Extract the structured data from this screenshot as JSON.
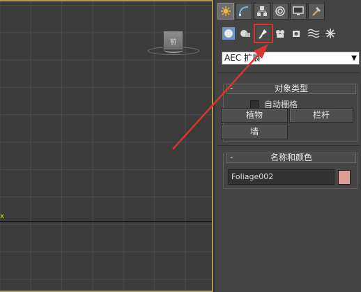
{
  "viewport": {
    "axis_label": "x",
    "gizmo_label": "前"
  },
  "panel": {
    "tabs": [
      {
        "name": "create-tab-icon",
        "glyph": "✸",
        "active": true
      },
      {
        "name": "modify-tab-icon",
        "glyph": "◜"
      },
      {
        "name": "hierarchy-tab-icon",
        "glyph": "⚑"
      },
      {
        "name": "motion-tab-icon",
        "glyph": "◎"
      },
      {
        "name": "display-tab-icon",
        "glyph": "▭"
      },
      {
        "name": "utilities-tab-icon",
        "glyph": "⚒"
      }
    ],
    "subcategory_icons": [
      {
        "name": "geometry-icon",
        "glyph": "●"
      },
      {
        "name": "shapes-icon",
        "glyph": "◐"
      },
      {
        "name": "lights-icon",
        "glyph": "✎",
        "selected": true
      },
      {
        "name": "cameras-icon",
        "glyph": "⊙"
      },
      {
        "name": "helpers-icon",
        "glyph": "◨"
      },
      {
        "name": "space-warps-icon",
        "glyph": "≋"
      },
      {
        "name": "systems-icon",
        "glyph": "✱"
      }
    ],
    "dropdown": {
      "selected": "AEC 扩展"
    },
    "object_type": {
      "title": "对象类型",
      "toggle": "-",
      "autogrid_label": "自动栅格",
      "buttons": {
        "foliage": "植物",
        "railing": "栏杆",
        "wall": "墙"
      }
    },
    "name_color": {
      "title": "名称和颜色",
      "toggle": "-",
      "name_value": "Foliage002",
      "swatch_color": "#e19a9a"
    }
  },
  "colors": {
    "annotation": "#d9352c",
    "viewport_border": "#b49a47"
  }
}
